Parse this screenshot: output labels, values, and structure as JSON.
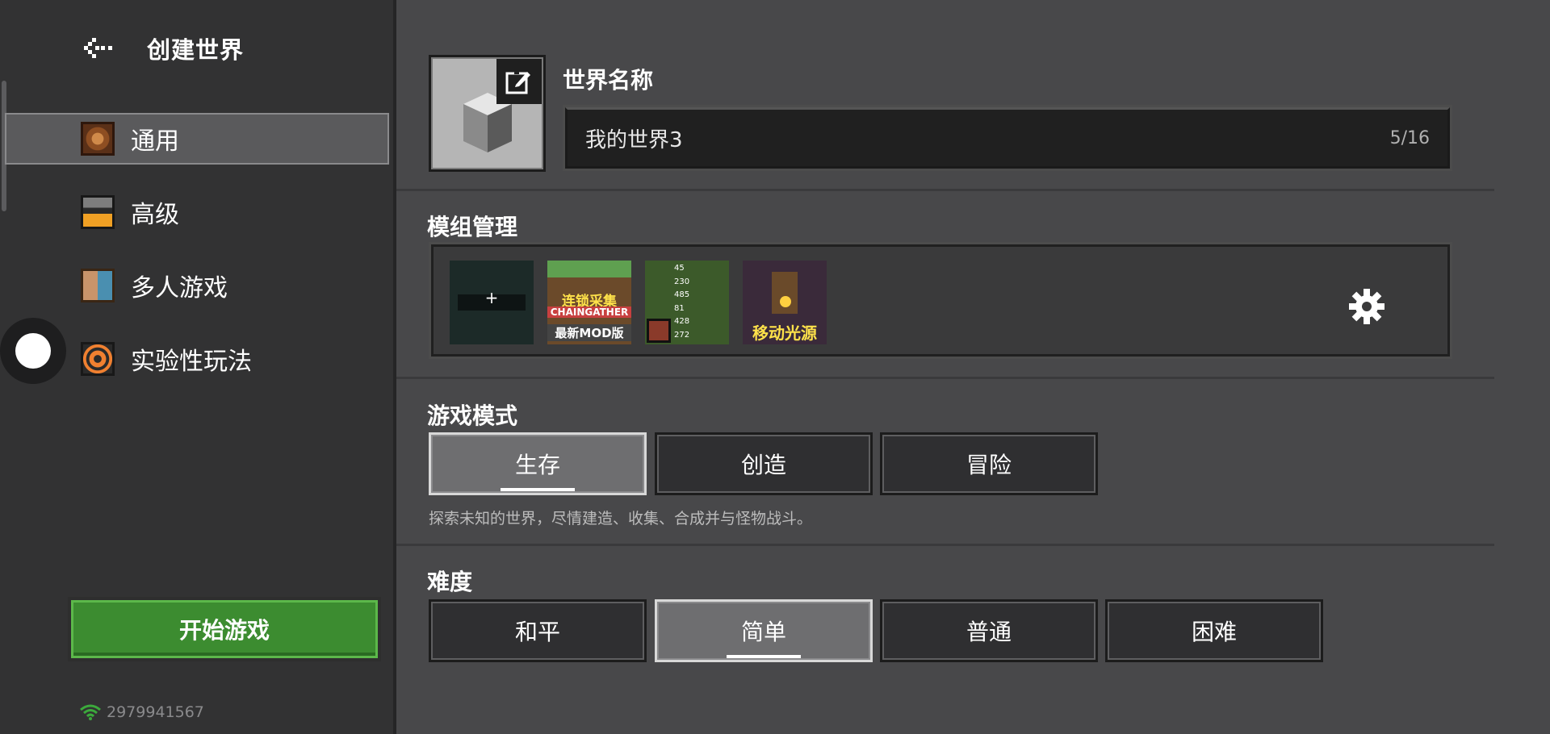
{
  "header": {
    "back_icon": "back-arrow-icon",
    "title": "创建世界"
  },
  "sidebar": {
    "items": [
      {
        "label": "通用",
        "icon": "general-icon",
        "active": true
      },
      {
        "label": "高级",
        "icon": "advanced-icon",
        "active": false
      },
      {
        "label": "多人游戏",
        "icon": "multiplayer-icon",
        "active": false
      },
      {
        "label": "实验性玩法",
        "icon": "experimental-icon",
        "active": false
      }
    ],
    "start_button": "开始游戏",
    "network_id": "2979941567",
    "accent_color": "#3c8c30"
  },
  "world": {
    "name_label": "世界名称",
    "name_value": "我的世界3",
    "name_count": "5/16"
  },
  "mods": {
    "label": "模组管理",
    "items": [
      {
        "name": "add-mod",
        "text": "+"
      },
      {
        "name": "chaingather",
        "text_top": "连锁采集",
        "text_mid": "CHAINGATHER",
        "text_bot": "最新MOD版"
      },
      {
        "name": "stats-mod",
        "values": [
          "45",
          "230",
          "485",
          "81",
          "428",
          "272"
        ]
      },
      {
        "name": "dynamic-light",
        "text": "移动光源"
      }
    ]
  },
  "game_mode": {
    "label": "游戏模式",
    "options": [
      "生存",
      "创造",
      "冒险"
    ],
    "selected": "生存",
    "description": "探索未知的世界，尽情建造、收集、合成并与怪物战斗。"
  },
  "difficulty": {
    "label": "难度",
    "options": [
      "和平",
      "简单",
      "普通",
      "困难"
    ],
    "selected": "简单"
  }
}
